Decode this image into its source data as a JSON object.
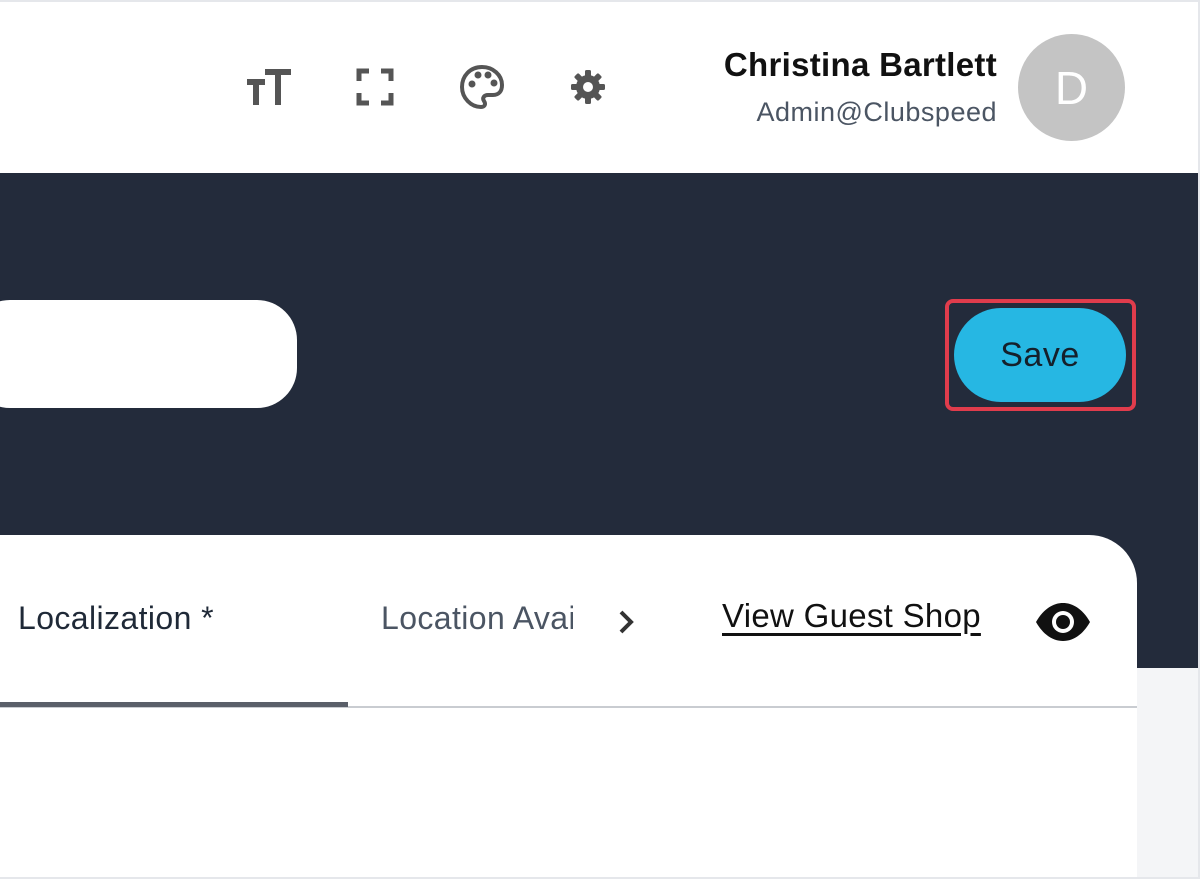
{
  "header": {
    "icons": [
      "text-size-icon",
      "fullscreen-icon",
      "palette-icon",
      "gear-icon"
    ],
    "user": {
      "name": "Christina Bartlett",
      "role": "Admin@Clubspeed",
      "avatar_initial": "D"
    }
  },
  "form": {
    "name_input_value": "",
    "save_label": "Save"
  },
  "tabs": {
    "items": [
      {
        "label": "Localization *",
        "active": true
      },
      {
        "label": "Location Availability",
        "active": false
      }
    ],
    "view_guest_shop": "View Guest Shop"
  },
  "colors": {
    "navy": "#232b3b",
    "accent": "#26b7e3",
    "highlight": "#e03c4c",
    "avatar": "#c4c4c4"
  }
}
